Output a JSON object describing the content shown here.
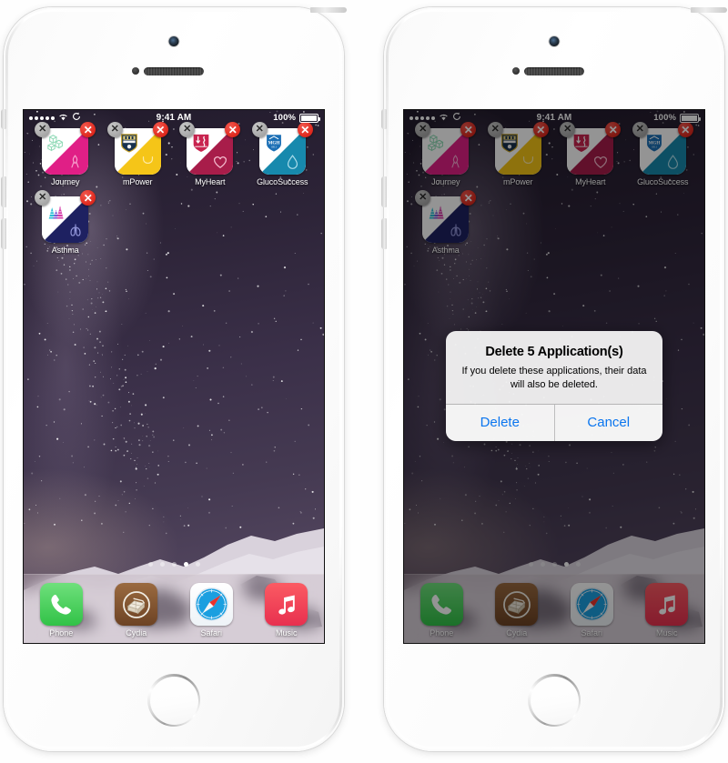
{
  "phones": [
    {
      "id": "left-phone",
      "name": "iphone-editing-mode",
      "dimmed": false,
      "alert_visible": false
    },
    {
      "id": "right-phone",
      "name": "iphone-delete-confirmation",
      "dimmed": true,
      "alert_visible": true
    }
  ],
  "status_bar": {
    "signal_dots": 5,
    "wifi_icon": "wifi-icon",
    "rotation_lock_icon": "rotation-sync-icon",
    "time": "9:41 AM",
    "battery_percent": "100%",
    "battery_icon": "battery-full-icon"
  },
  "home_screen": {
    "apps": [
      {
        "label": "Journey",
        "icon_name": "journey-app-icon",
        "top_color": "#ffffff",
        "bottom_color": "#e01f86",
        "glyph_top": "cubes-icon",
        "glyph_bottom": "ribbon-icon",
        "glyph_top_color": "#8fd9b6",
        "glyph_bottom_color": "#f7a6cf"
      },
      {
        "label": "mPower",
        "icon_name": "mpower-app-icon",
        "top_color": "#ffffff",
        "bottom_color": "#f5c518",
        "glyph_top": "university-crest-icon",
        "glyph_bottom": "smile-icon",
        "glyph_top_color": "#1f3a5f",
        "glyph_bottom_color": "#fde9a0"
      },
      {
        "label": "MyHeart",
        "icon_name": "myheart-app-icon",
        "top_color": "#ffffff",
        "bottom_color": "#a81d4a",
        "glyph_top": "shield-crest-icon",
        "glyph_bottom": "heart-outline-icon",
        "glyph_top_color": "#c8244f",
        "glyph_bottom_color": "#f3b8cb"
      },
      {
        "label": "GlucoSuccess",
        "icon_name": "glucosuccess-app-icon",
        "top_color": "#ffffff",
        "bottom_color": "#1789ad",
        "glyph_top": "mgh-shield-icon",
        "glyph_bottom": "water-droplet-icon",
        "glyph_top_color": "#1b6fb5",
        "glyph_bottom_color": "#aadcea"
      },
      {
        "label": "Asthma",
        "icon_name": "asthma-app-icon",
        "top_color": "#ffffff",
        "bottom_color": "#1e2161",
        "glyph_top": "mountain-chart-icon",
        "glyph_bottom": "lungs-icon",
        "glyph_top_color": "#2bbfd4",
        "glyph_bottom_color": "#8f93d6"
      }
    ],
    "delete_badge_label": "x",
    "remove_badge_label": "X",
    "page_dots": {
      "count": 5,
      "active_index": 3
    }
  },
  "dock": {
    "items": [
      {
        "label": "Phone",
        "icon_name": "phone-handset-icon",
        "color": "#4cd25f"
      },
      {
        "label": "Cydia",
        "icon_name": "cydia-package-icon",
        "color": "#8a5a34"
      },
      {
        "label": "Safari",
        "icon_name": "safari-compass-icon",
        "color": "#1a9fe0"
      },
      {
        "label": "Music",
        "icon_name": "music-note-icon",
        "color": "#f0475c"
      }
    ]
  },
  "alert": {
    "title": "Delete 5 Application(s)",
    "message": "If you delete these applications, their data will also be deleted.",
    "buttons": [
      {
        "label": "Delete",
        "name": "alert-delete-button",
        "color": "#0b76ef"
      },
      {
        "label": "Cancel",
        "name": "alert-cancel-button",
        "color": "#0b76ef"
      }
    ]
  },
  "colors": {
    "accent_blue": "#0b76ef",
    "badge_red": "#e02b20",
    "badge_grey": "#a6a6a6",
    "device_body": "#fdfdfd"
  }
}
